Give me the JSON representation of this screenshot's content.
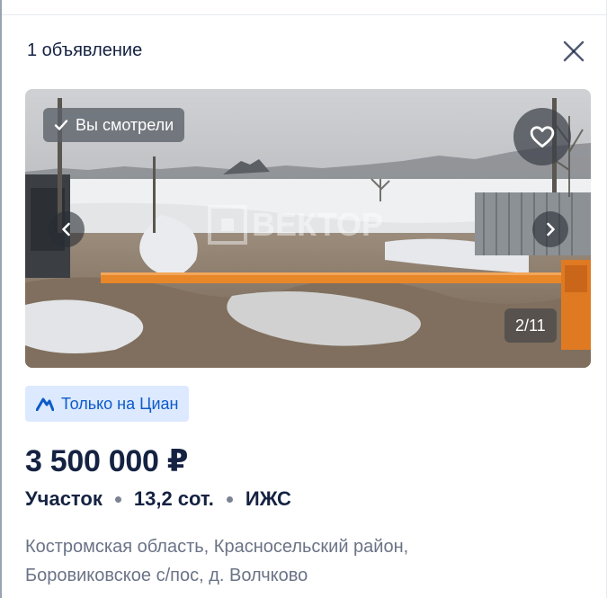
{
  "panel": {
    "title": "1 объявление"
  },
  "close": {
    "icon": "close-icon"
  },
  "gallery": {
    "viewed_label": "Вы смотрели",
    "counter": "2/11",
    "watermark": "ВЕКТОР",
    "icons": {
      "viewed": "check-icon",
      "favorite": "heart-icon",
      "prev": "chevron-left-icon",
      "next": "chevron-right-icon"
    }
  },
  "badge": {
    "label": "Только на Циан",
    "icon": "cian-logo-icon",
    "bg_color": "#dce9ff",
    "text_color": "#0d5bc8"
  },
  "listing": {
    "price": "3 500 000 ₽",
    "type": "Участок",
    "area": "13,2 сот.",
    "category": "ИЖС",
    "address_line1": "Костромская область, Красносельский район,",
    "address_line2": "Боровиковское с/пос, д. Волчково"
  },
  "colors": {
    "text_primary": "#152242",
    "text_secondary": "#6b7387",
    "barrier": "#e8862a"
  }
}
